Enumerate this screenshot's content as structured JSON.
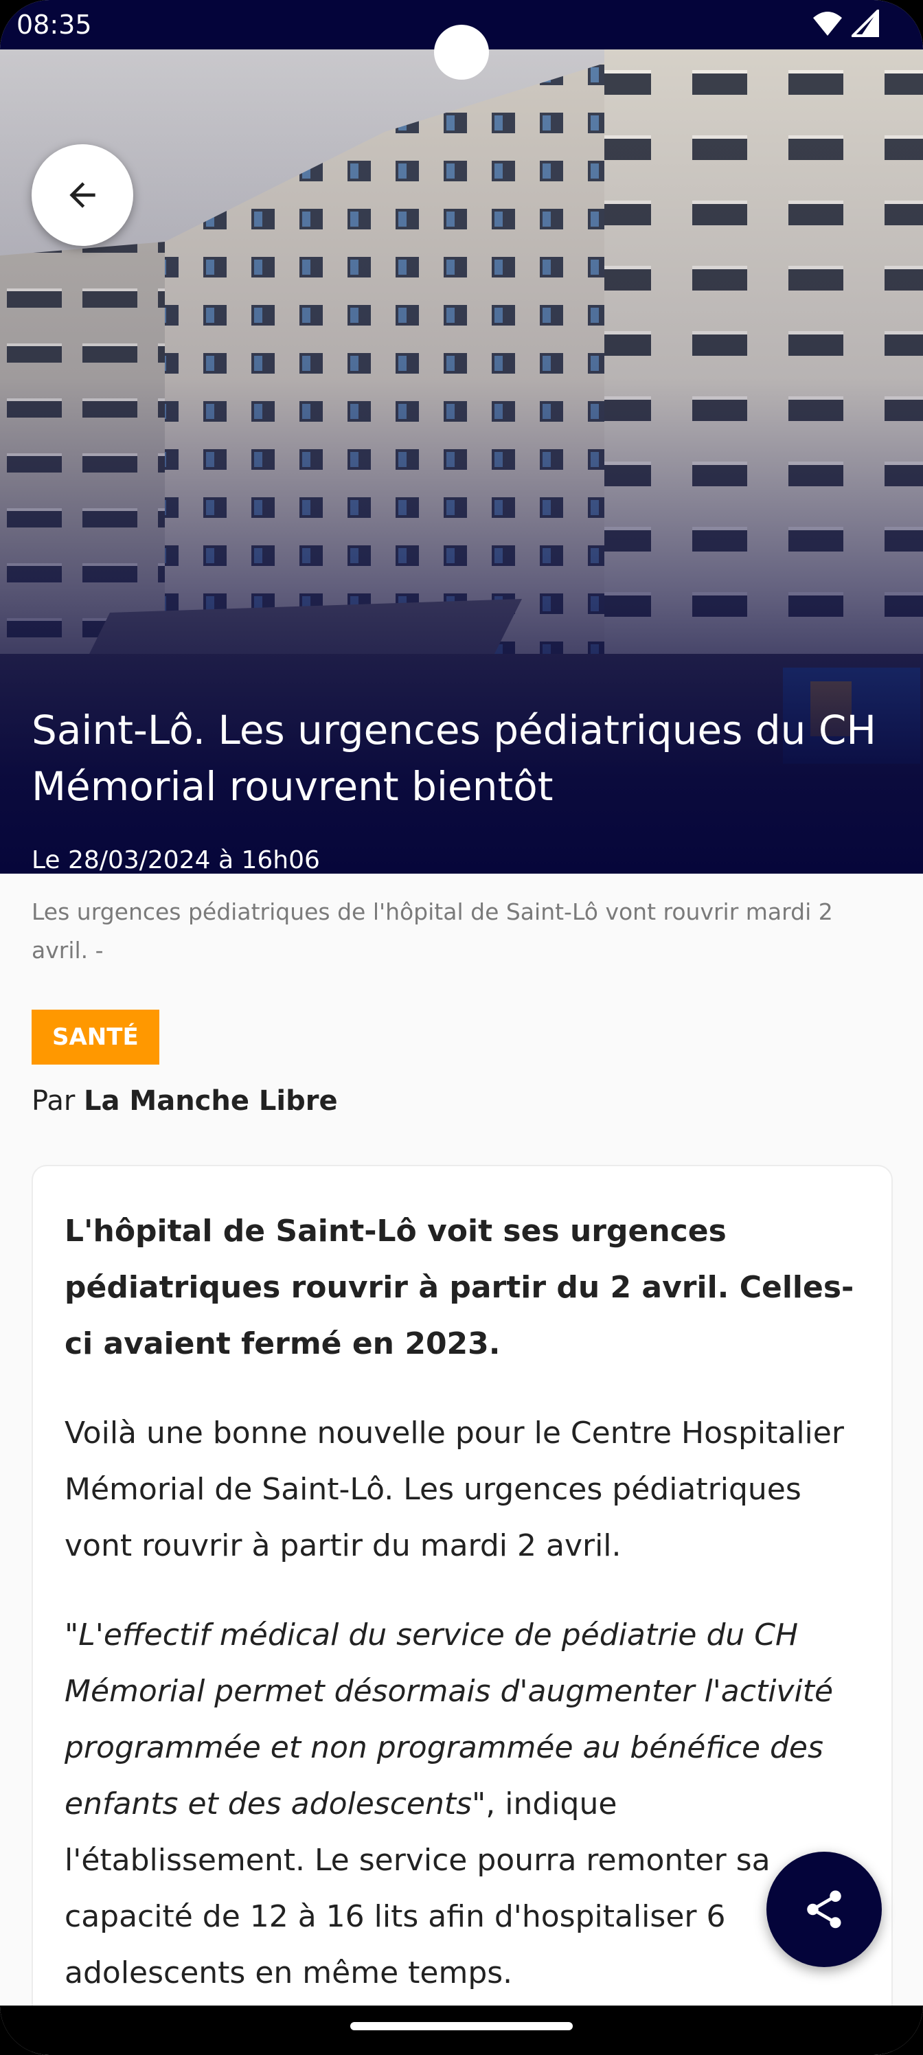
{
  "status_bar": {
    "time": "08:35",
    "icons": [
      "wifi-icon",
      "signal-icon"
    ]
  },
  "hero": {
    "back_icon": "arrow-left-icon",
    "title": "Saint-Lô. Les urgences pédiatriques du CH Mémorial rouvrent bientôt",
    "date": "Le 28/03/2024 à 16h06"
  },
  "article": {
    "caption": "Les urgences pédiatriques de l'hôpital de Saint-Lô vont rouvrir mardi 2 avril. -",
    "category": "SANTÉ",
    "byline_prefix": "Par",
    "author": "La Manche Libre",
    "lead": "L'hôpital de Saint-Lô voit ses urgences pédiatriques rouvrir à partir du 2 avril. Celles-ci avaient fermé en 2023.",
    "paragraph_1": "Voilà une bonne nouvelle pour le Centre Hospitalier Mémorial de Saint-Lô. Les urgences pédiatriques vont rouvrir à partir du mardi 2 avril.",
    "quote_open": "\"",
    "quote_italic": "L'effectif médical du service de pédiatrie du CH Mémorial permet désormais d'augmenter l'activité programmée et non programmée au bénéfice des enfants et des adolescents",
    "quote_rest": "\", indique l'établissement. Le service pourra remonter sa capacité de 12 à 16 lits afin d'hospitaliser 6 adolescents en même temps."
  },
  "share": {
    "icon": "share-icon"
  },
  "colors": {
    "navy": "#04043a",
    "badge_orange": "#ff9800",
    "background": "#fafafa"
  }
}
